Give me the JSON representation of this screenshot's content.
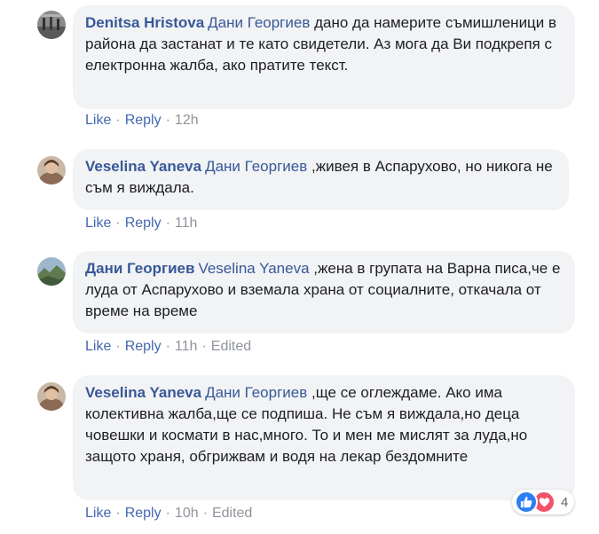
{
  "comments": [
    {
      "author": "Denitsa Hristova",
      "mention": "Дани Георгиев",
      "text": "дано да намерите съмишленици в района да застанат и те като свидетели. Аз мога да Ви подкрепя с електронна жалба, ако пратите текст.",
      "like_label": "Like",
      "reply_label": "Reply",
      "time": "12h",
      "edited": ""
    },
    {
      "author": "Veselina Yaneva",
      "mention": "Дани Георгиев",
      "text": ",живея в Аспарухово, но никога не съм я виждала.",
      "like_label": "Like",
      "reply_label": "Reply",
      "time": "11h",
      "edited": ""
    },
    {
      "author": "Дани Георгиев",
      "mention": "Veselina Yaneva",
      "text": ",жена в групата на Варна писа,че е луда от Аспарухово и вземала храна от социалните, откачала от време на време",
      "like_label": "Like",
      "reply_label": "Reply",
      "time": "11h",
      "edited": "Edited"
    },
    {
      "author": "Veselina Yaneva",
      "mention": "Дани Георгиев",
      "text": ",ще се оглеждаме. Ако има колективна жалба,ще се подпиша. Не съм я виждала,но деца човешки и космати в нас,много. То и мен ме мислят за луда,но защото храня, обгрижвам и водя на лекар бездомните",
      "like_label": "Like",
      "reply_label": "Reply",
      "time": "10h",
      "edited": "Edited"
    }
  ],
  "reactions": {
    "icons": [
      "like-icon",
      "love-icon"
    ],
    "count": "4"
  },
  "colors": {
    "author": "#385898",
    "bubble": "#f2f3f5",
    "action_link": "#4267b2",
    "meta": "#90949c"
  }
}
